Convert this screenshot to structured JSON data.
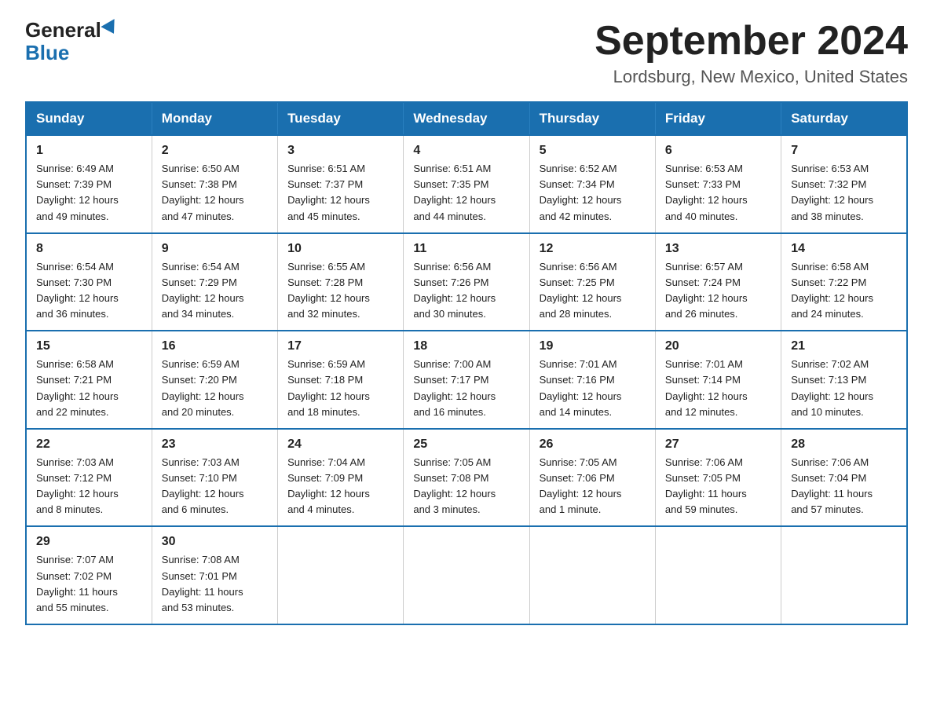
{
  "logo": {
    "general": "General",
    "blue": "Blue"
  },
  "header": {
    "title": "September 2024",
    "subtitle": "Lordsburg, New Mexico, United States"
  },
  "weekdays": [
    "Sunday",
    "Monday",
    "Tuesday",
    "Wednesday",
    "Thursday",
    "Friday",
    "Saturday"
  ],
  "weeks": [
    [
      {
        "day": "1",
        "sunrise": "6:49 AM",
        "sunset": "7:39 PM",
        "daylight": "12 hours and 49 minutes."
      },
      {
        "day": "2",
        "sunrise": "6:50 AM",
        "sunset": "7:38 PM",
        "daylight": "12 hours and 47 minutes."
      },
      {
        "day": "3",
        "sunrise": "6:51 AM",
        "sunset": "7:37 PM",
        "daylight": "12 hours and 45 minutes."
      },
      {
        "day": "4",
        "sunrise": "6:51 AM",
        "sunset": "7:35 PM",
        "daylight": "12 hours and 44 minutes."
      },
      {
        "day": "5",
        "sunrise": "6:52 AM",
        "sunset": "7:34 PM",
        "daylight": "12 hours and 42 minutes."
      },
      {
        "day": "6",
        "sunrise": "6:53 AM",
        "sunset": "7:33 PM",
        "daylight": "12 hours and 40 minutes."
      },
      {
        "day": "7",
        "sunrise": "6:53 AM",
        "sunset": "7:32 PM",
        "daylight": "12 hours and 38 minutes."
      }
    ],
    [
      {
        "day": "8",
        "sunrise": "6:54 AM",
        "sunset": "7:30 PM",
        "daylight": "12 hours and 36 minutes."
      },
      {
        "day": "9",
        "sunrise": "6:54 AM",
        "sunset": "7:29 PM",
        "daylight": "12 hours and 34 minutes."
      },
      {
        "day": "10",
        "sunrise": "6:55 AM",
        "sunset": "7:28 PM",
        "daylight": "12 hours and 32 minutes."
      },
      {
        "day": "11",
        "sunrise": "6:56 AM",
        "sunset": "7:26 PM",
        "daylight": "12 hours and 30 minutes."
      },
      {
        "day": "12",
        "sunrise": "6:56 AM",
        "sunset": "7:25 PM",
        "daylight": "12 hours and 28 minutes."
      },
      {
        "day": "13",
        "sunrise": "6:57 AM",
        "sunset": "7:24 PM",
        "daylight": "12 hours and 26 minutes."
      },
      {
        "day": "14",
        "sunrise": "6:58 AM",
        "sunset": "7:22 PM",
        "daylight": "12 hours and 24 minutes."
      }
    ],
    [
      {
        "day": "15",
        "sunrise": "6:58 AM",
        "sunset": "7:21 PM",
        "daylight": "12 hours and 22 minutes."
      },
      {
        "day": "16",
        "sunrise": "6:59 AM",
        "sunset": "7:20 PM",
        "daylight": "12 hours and 20 minutes."
      },
      {
        "day": "17",
        "sunrise": "6:59 AM",
        "sunset": "7:18 PM",
        "daylight": "12 hours and 18 minutes."
      },
      {
        "day": "18",
        "sunrise": "7:00 AM",
        "sunset": "7:17 PM",
        "daylight": "12 hours and 16 minutes."
      },
      {
        "day": "19",
        "sunrise": "7:01 AM",
        "sunset": "7:16 PM",
        "daylight": "12 hours and 14 minutes."
      },
      {
        "day": "20",
        "sunrise": "7:01 AM",
        "sunset": "7:14 PM",
        "daylight": "12 hours and 12 minutes."
      },
      {
        "day": "21",
        "sunrise": "7:02 AM",
        "sunset": "7:13 PM",
        "daylight": "12 hours and 10 minutes."
      }
    ],
    [
      {
        "day": "22",
        "sunrise": "7:03 AM",
        "sunset": "7:12 PM",
        "daylight": "12 hours and 8 minutes."
      },
      {
        "day": "23",
        "sunrise": "7:03 AM",
        "sunset": "7:10 PM",
        "daylight": "12 hours and 6 minutes."
      },
      {
        "day": "24",
        "sunrise": "7:04 AM",
        "sunset": "7:09 PM",
        "daylight": "12 hours and 4 minutes."
      },
      {
        "day": "25",
        "sunrise": "7:05 AM",
        "sunset": "7:08 PM",
        "daylight": "12 hours and 3 minutes."
      },
      {
        "day": "26",
        "sunrise": "7:05 AM",
        "sunset": "7:06 PM",
        "daylight": "12 hours and 1 minute."
      },
      {
        "day": "27",
        "sunrise": "7:06 AM",
        "sunset": "7:05 PM",
        "daylight": "11 hours and 59 minutes."
      },
      {
        "day": "28",
        "sunrise": "7:06 AM",
        "sunset": "7:04 PM",
        "daylight": "11 hours and 57 minutes."
      }
    ],
    [
      {
        "day": "29",
        "sunrise": "7:07 AM",
        "sunset": "7:02 PM",
        "daylight": "11 hours and 55 minutes."
      },
      {
        "day": "30",
        "sunrise": "7:08 AM",
        "sunset": "7:01 PM",
        "daylight": "11 hours and 53 minutes."
      },
      null,
      null,
      null,
      null,
      null
    ]
  ],
  "sunrise_label": "Sunrise:",
  "sunset_label": "Sunset:",
  "daylight_label": "Daylight:"
}
